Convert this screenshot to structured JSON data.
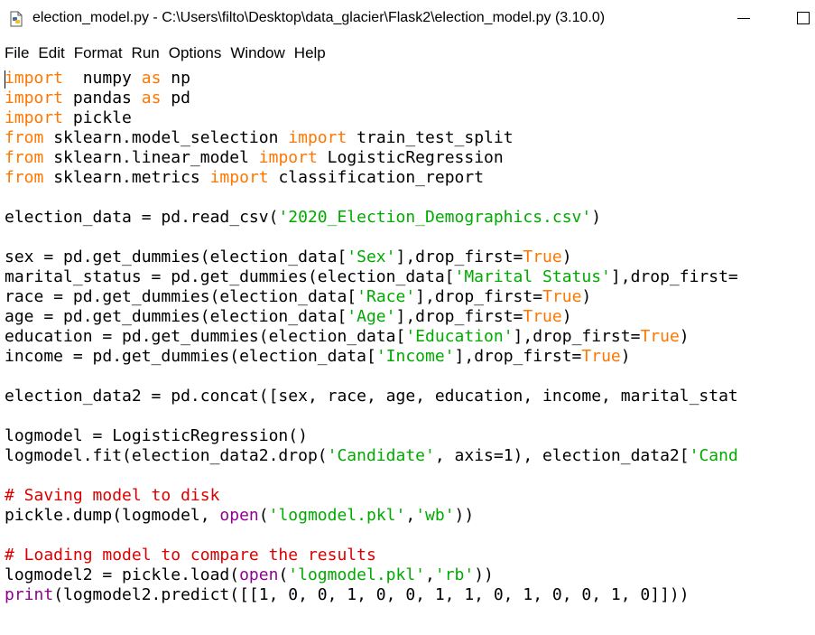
{
  "window": {
    "title": "election_model.py - C:\\Users\\filto\\Desktop\\data_glacier\\Flask2\\election_model.py (3.10.0)"
  },
  "menu": [
    "File",
    "Edit",
    "Format",
    "Run",
    "Options",
    "Window",
    "Help"
  ],
  "colors": {
    "keyword": "#ff7700",
    "builtin": "#900090",
    "string": "#00aa00",
    "comment": "#dd0000",
    "default": "#000000"
  },
  "code": {
    "lines": [
      [
        [
          "kw",
          "import"
        ],
        [
          "",
          "  numpy "
        ],
        [
          "kw",
          "as"
        ],
        [
          "",
          " np"
        ]
      ],
      [
        [
          "kw",
          "import"
        ],
        [
          "",
          " pandas "
        ],
        [
          "kw",
          "as"
        ],
        [
          "",
          " pd"
        ]
      ],
      [
        [
          "kw",
          "import"
        ],
        [
          "",
          " pickle"
        ]
      ],
      [
        [
          "kw",
          "from"
        ],
        [
          "",
          " sklearn.model_selection "
        ],
        [
          "kw",
          "import"
        ],
        [
          "",
          " train_test_split"
        ]
      ],
      [
        [
          "kw",
          "from"
        ],
        [
          "",
          " sklearn.linear_model "
        ],
        [
          "kw",
          "import"
        ],
        [
          "",
          " LogisticRegression"
        ]
      ],
      [
        [
          "kw",
          "from"
        ],
        [
          "",
          " sklearn.metrics "
        ],
        [
          "kw",
          "import"
        ],
        [
          "",
          " classification_report"
        ]
      ],
      [],
      [
        [
          "",
          "election_data = pd.read_csv("
        ],
        [
          "str",
          "'2020_Election_Demographics.csv'"
        ],
        [
          "",
          ")"
        ]
      ],
      [],
      [
        [
          "",
          "sex = pd.get_dummies(election_data["
        ],
        [
          "str",
          "'Sex'"
        ],
        [
          "",
          "],drop_first="
        ],
        [
          "kw",
          "True"
        ],
        [
          "",
          ")"
        ]
      ],
      [
        [
          "",
          "marital_status = pd.get_dummies(election_data["
        ],
        [
          "str",
          "'Marital Status'"
        ],
        [
          "",
          "],drop_first="
        ]
      ],
      [
        [
          "",
          "race = pd.get_dummies(election_data["
        ],
        [
          "str",
          "'Race'"
        ],
        [
          "",
          "],drop_first="
        ],
        [
          "kw",
          "True"
        ],
        [
          "",
          ")"
        ]
      ],
      [
        [
          "",
          "age = pd.get_dummies(election_data["
        ],
        [
          "str",
          "'Age'"
        ],
        [
          "",
          "],drop_first="
        ],
        [
          "kw",
          "True"
        ],
        [
          "",
          ")"
        ]
      ],
      [
        [
          "",
          "education = pd.get_dummies(election_data["
        ],
        [
          "str",
          "'Education'"
        ],
        [
          "",
          "],drop_first="
        ],
        [
          "kw",
          "True"
        ],
        [
          "",
          ")"
        ]
      ],
      [
        [
          "",
          "income = pd.get_dummies(election_data["
        ],
        [
          "str",
          "'Income'"
        ],
        [
          "",
          "],drop_first="
        ],
        [
          "kw",
          "True"
        ],
        [
          "",
          ")"
        ]
      ],
      [],
      [
        [
          "",
          "election_data2 = pd.concat([sex, race, age, education, income, marital_stat"
        ]
      ],
      [],
      [
        [
          "",
          "logmodel = LogisticRegression()"
        ]
      ],
      [
        [
          "",
          "logmodel.fit(election_data2.drop("
        ],
        [
          "str",
          "'Candidate'"
        ],
        [
          "",
          ", axis=1), election_data2["
        ],
        [
          "str",
          "'Cand"
        ]
      ],
      [],
      [
        [
          "cm",
          "# Saving model to disk"
        ]
      ],
      [
        [
          "",
          "pickle.dump(logmodel, "
        ],
        [
          "bi",
          "open"
        ],
        [
          "",
          "("
        ],
        [
          "str",
          "'logmodel.pkl'"
        ],
        [
          "",
          ","
        ],
        [
          "str",
          "'wb'"
        ],
        [
          "",
          "))"
        ]
      ],
      [],
      [
        [
          "cm",
          "# Loading model to compare the results"
        ]
      ],
      [
        [
          "",
          "logmodel2 = pickle.load("
        ],
        [
          "bi",
          "open"
        ],
        [
          "",
          "("
        ],
        [
          "str",
          "'logmodel.pkl'"
        ],
        [
          "",
          ","
        ],
        [
          "str",
          "'rb'"
        ],
        [
          "",
          "))"
        ]
      ],
      [
        [
          "bi",
          "print"
        ],
        [
          "",
          "(logmodel2.predict([[1, 0, 0, 1, 0, 0, 1, 1, 0, 1, 0, 0, 1, 0]]))"
        ]
      ]
    ]
  }
}
